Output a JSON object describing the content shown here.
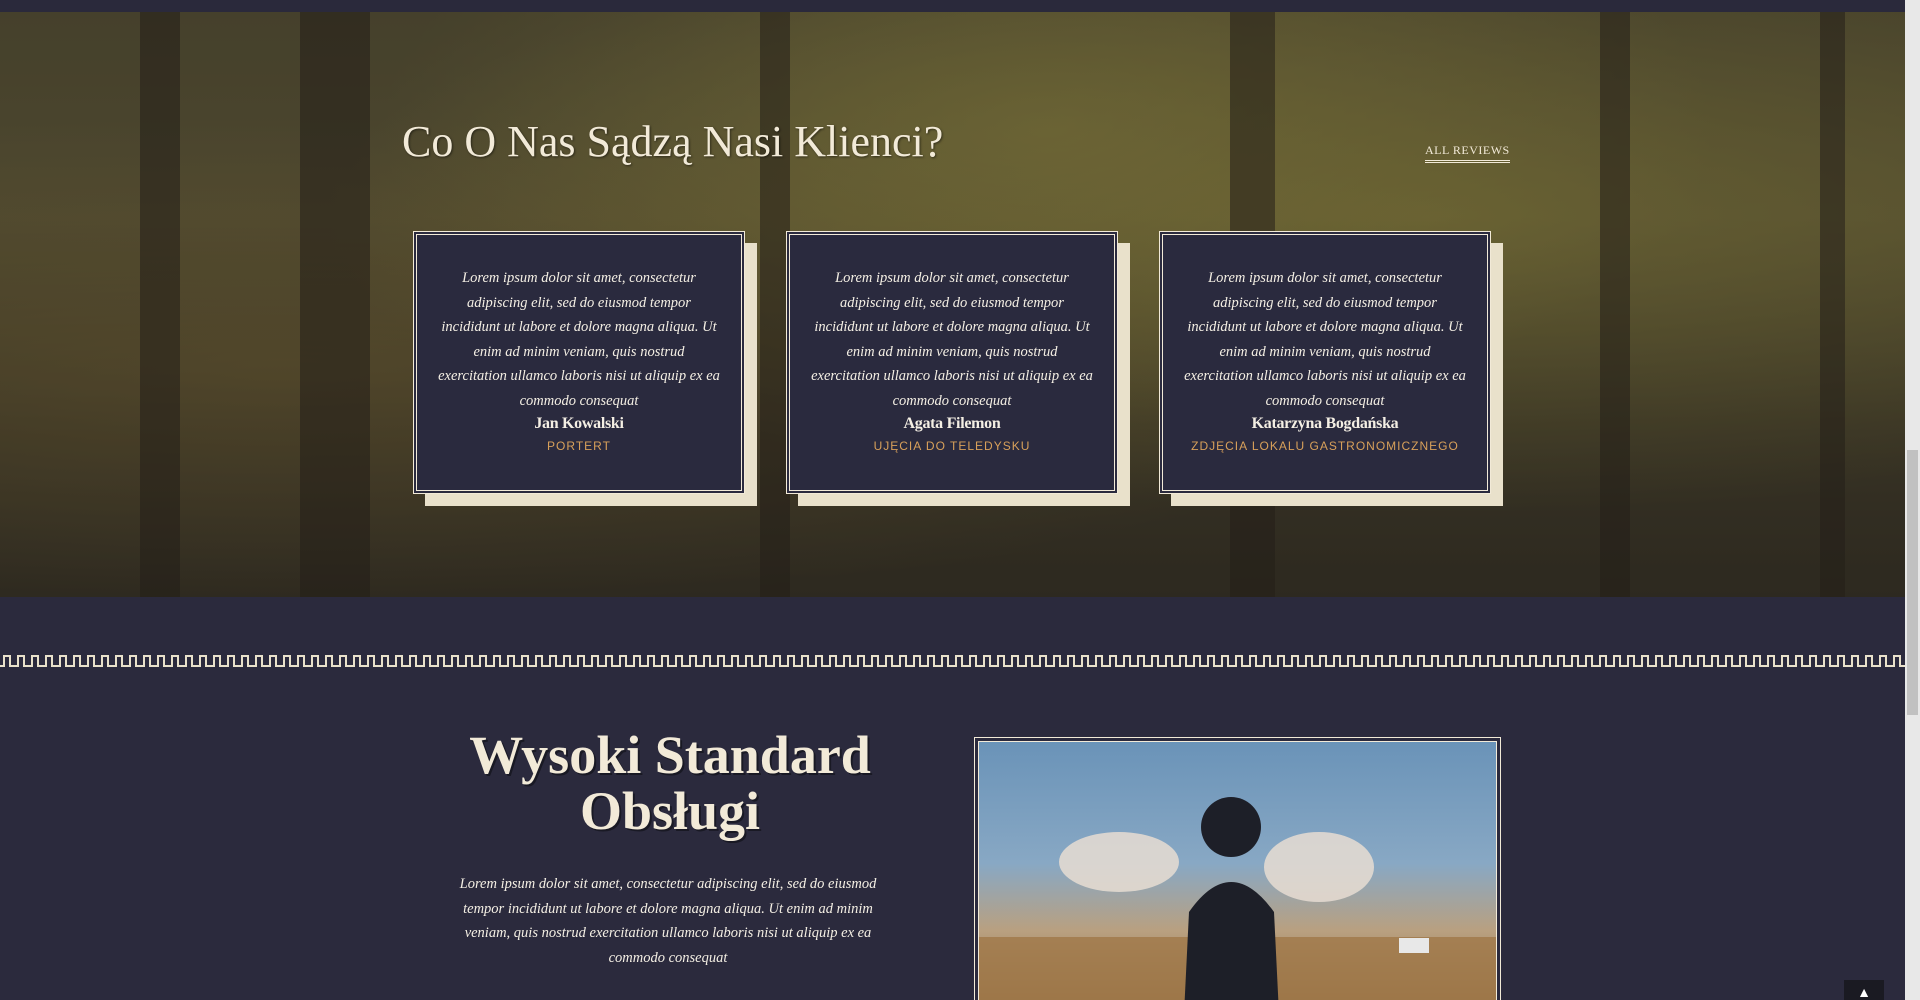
{
  "testimonials": {
    "title": "Co O Nas Sądzą Nasi Klienci?",
    "all_reviews_label": "ALL REVIEWS",
    "items": [
      {
        "text": "Lorem ipsum dolor sit amet, consectetur adipiscing elit, sed do eiusmod tempor incididunt ut labore et dolore magna aliqua. Ut enim ad minim veniam, quis nostrud exercitation ullamco laboris nisi ut aliquip ex ea commodo consequat",
        "name": "Jan Kowalski",
        "role": "PORTERT"
      },
      {
        "text": "Lorem ipsum dolor sit amet, consectetur adipiscing elit, sed do eiusmod tempor incididunt ut labore et dolore magna aliqua. Ut enim ad minim veniam, quis nostrud exercitation ullamco laboris nisi ut aliquip ex ea commodo consequat",
        "name": "Agata Filemon",
        "role": "UJĘCIA DO TELEDYSKU"
      },
      {
        "text": "Lorem ipsum dolor sit amet, consectetur adipiscing elit, sed do eiusmod tempor incididunt ut labore et dolore magna aliqua. Ut enim ad minim veniam, quis nostrud exercitation ullamco laboris nisi ut aliquip ex ea commodo consequat",
        "name": "Katarzyna Bogdańska",
        "role": "ZDJĘCIA LOKALU GASTRONOMICZNEGO"
      }
    ]
  },
  "standard": {
    "title": "Wysoki Standard Obsługi",
    "text": "Lorem ipsum dolor sit amet, consectetur adipiscing elit, sed do eiusmod tempor incididunt ut labore et dolore magna aliqua. Ut enim ad minim veniam, quis nostrud exercitation ullamco laboris nisi ut aliquip ex ea commodo consequat"
  },
  "colors": {
    "background": "#2b2a3d",
    "cream": "#f2ead8",
    "accent": "#d8a05a"
  },
  "icons": {
    "back_to_top": "chevron-up-icon"
  }
}
